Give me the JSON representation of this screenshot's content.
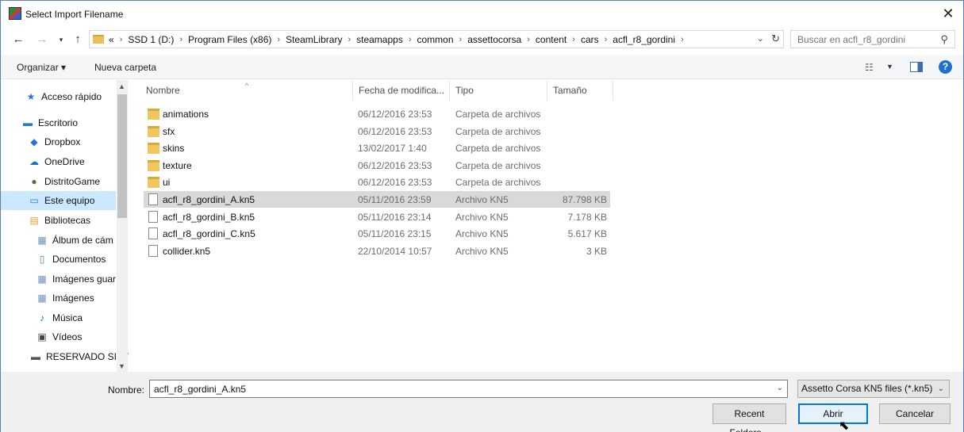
{
  "window": {
    "title": "Select Import Filename"
  },
  "address": {
    "crumbs": [
      "SSD 1 (D:)",
      "Program Files (x86)",
      "SteamLibrary",
      "steamapps",
      "common",
      "assettocorsa",
      "content",
      "cars",
      "acfl_r8_gordini"
    ],
    "overflow": "«"
  },
  "search": {
    "placeholder": "Buscar en acfl_r8_gordini"
  },
  "toolbar": {
    "organize": "Organizar ▾",
    "new_folder": "Nueva carpeta"
  },
  "nav": [
    {
      "label": "Acceso rápido",
      "icon": "star-icon"
    },
    {
      "label": "Escritorio",
      "icon": "desktop-icon"
    },
    {
      "label": "Dropbox",
      "icon": "dropbox-icon"
    },
    {
      "label": "OneDrive",
      "icon": "onedrive-icon"
    },
    {
      "label": "DistritoGame",
      "icon": "user-icon"
    },
    {
      "label": "Este equipo",
      "icon": "computer-icon"
    },
    {
      "label": "Bibliotecas",
      "icon": "libraries-icon"
    },
    {
      "label": "Álbum de cám",
      "icon": "album-icon"
    },
    {
      "label": "Documentos",
      "icon": "documents-icon"
    },
    {
      "label": "Imágenes guar",
      "icon": "saved-pictures-icon"
    },
    {
      "label": "Imágenes",
      "icon": "pictures-icon"
    },
    {
      "label": "Música",
      "icon": "music-icon"
    },
    {
      "label": "Vídeos",
      "icon": "videos-icon"
    },
    {
      "label": "RESERVADO SIST",
      "icon": "drive-icon"
    }
  ],
  "columns": {
    "name": "Nombre",
    "date": "Fecha de modifica...",
    "type": "Tipo",
    "size": "Tamaño"
  },
  "files": [
    {
      "name": "animations",
      "date": "06/12/2016 23:53",
      "type": "Carpeta de archivos",
      "size": "",
      "kind": "folder"
    },
    {
      "name": "sfx",
      "date": "06/12/2016 23:53",
      "type": "Carpeta de archivos",
      "size": "",
      "kind": "folder"
    },
    {
      "name": "skins",
      "date": "13/02/2017 1:40",
      "type": "Carpeta de archivos",
      "size": "",
      "kind": "folder"
    },
    {
      "name": "texture",
      "date": "06/12/2016 23:53",
      "type": "Carpeta de archivos",
      "size": "",
      "kind": "folder"
    },
    {
      "name": "ui",
      "date": "06/12/2016 23:53",
      "type": "Carpeta de archivos",
      "size": "",
      "kind": "folder"
    },
    {
      "name": "acfl_r8_gordini_A.kn5",
      "date": "05/11/2016 23:59",
      "type": "Archivo KN5",
      "size": "87.798 KB",
      "kind": "file"
    },
    {
      "name": "acfl_r8_gordini_B.kn5",
      "date": "05/11/2016 23:14",
      "type": "Archivo KN5",
      "size": "7.178 KB",
      "kind": "file"
    },
    {
      "name": "acfl_r8_gordini_C.kn5",
      "date": "05/11/2016 23:15",
      "type": "Archivo KN5",
      "size": "5.617 KB",
      "kind": "file"
    },
    {
      "name": "collider.kn5",
      "date": "22/10/2014 10:57",
      "type": "Archivo KN5",
      "size": "3 KB",
      "kind": "file"
    }
  ],
  "bottom": {
    "name_label": "Nombre:",
    "name_value": "acfl_r8_gordini_A.kn5",
    "filter": "Assetto Corsa KN5 files (*.kn5)",
    "recent": "Recent Folders...",
    "open": "Abrir",
    "cancel": "Cancelar"
  }
}
